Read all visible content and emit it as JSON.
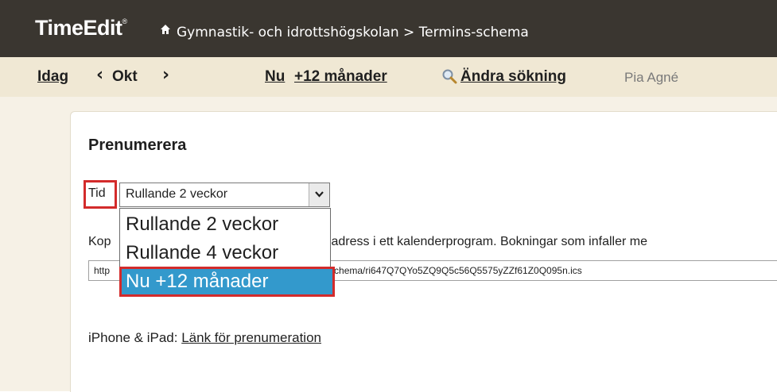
{
  "header": {
    "logo": "TimeEdit",
    "logo_mark": "®",
    "breadcrumb": "Gymnastik- och idrottshögskolan > Termins-schema"
  },
  "nav": {
    "today": "Idag",
    "month": "Okt",
    "now": "Nu",
    "plus12": "+12 månader",
    "change_search": "Ändra sökning",
    "user": "Pia Agné"
  },
  "subscribe": {
    "title": "Prenumerera",
    "tid_label": "Tid",
    "selected": "Rullande 2 veckor",
    "options": [
      "Rullande 2 veckor",
      "Rullande 4 veckor",
      "Nu +12 månader"
    ],
    "copy_prefix": "Kop",
    "copy_suffix": "adress i ett kalenderprogram. Bokningar som infaller me",
    "url_prefix": "http",
    "url_suffix": "schema/ri647Q7QYo5ZQ9Q5c56Q5575yZZf61Z0Q095n.ics",
    "iphone_label": "iPhone & iPad:",
    "iphone_link": "Länk för prenumeration"
  },
  "colors": {
    "header_bg": "#3a3630",
    "nav_bg": "#f0e8d4",
    "highlight_red": "#d32b2b",
    "selected_blue": "#3399cc"
  }
}
